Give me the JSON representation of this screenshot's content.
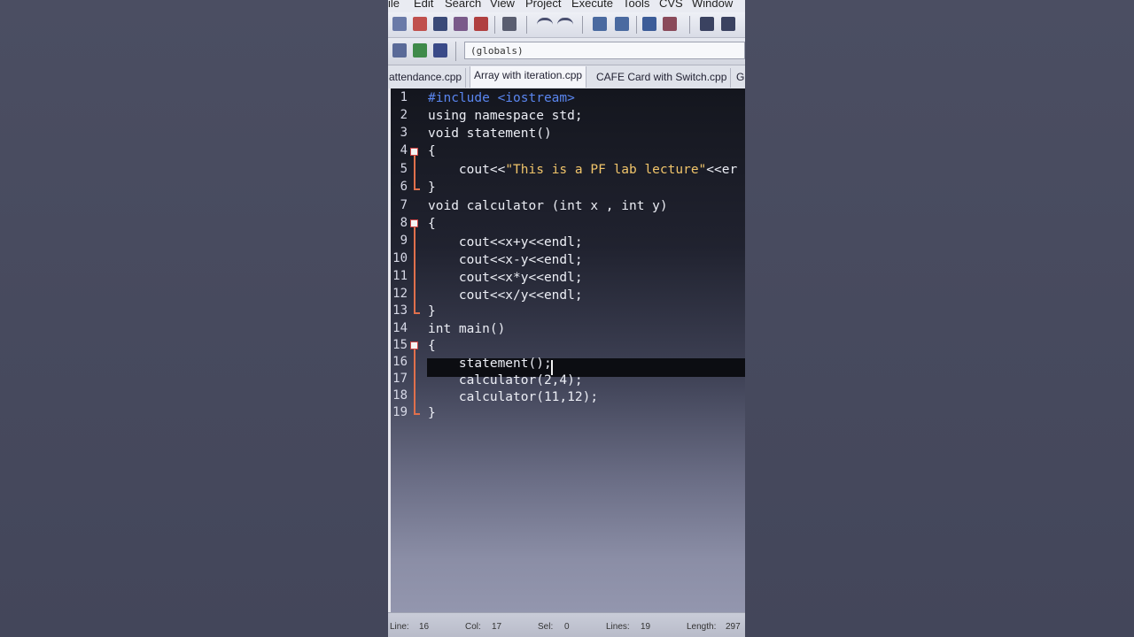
{
  "menu": [
    "ile",
    "Edit",
    "Search",
    "View",
    "Project",
    "Execute",
    "Tools",
    "CVS",
    "Window"
  ],
  "toolbar": {
    "scope_dropdown": "(globals)"
  },
  "tabs": [
    {
      "label": "attendance.cpp",
      "active": false
    },
    {
      "label": "Array with iteration.cpp",
      "active": true
    },
    {
      "label": "CAFE Card with Switch.cpp",
      "active": false
    },
    {
      "label": "G",
      "active": false
    }
  ],
  "editor": {
    "line_numbers": [
      "1",
      "2",
      "3",
      "4",
      "5",
      "6",
      "7",
      "8",
      "9",
      "10",
      "11",
      "12",
      "13",
      "14",
      "15",
      "16",
      "17",
      "18",
      "19"
    ],
    "lines": {
      "l1": "#include <iostream>",
      "l2": "using namespace std;",
      "l3": "void statement()",
      "l4": "{",
      "l5_a": "    cout<<",
      "l5_str": "\"This is a PF lab lecture\"",
      "l5_b": "<<er",
      "l6": "}",
      "l7": "void calculator (int x , int y)",
      "l8": "{",
      "l9": "    cout<<x+y<<endl;",
      "l10": "    cout<<x-y<<endl;",
      "l11": "    cout<<x*y<<endl;",
      "l12": "    cout<<x/y<<endl;",
      "l13": "}",
      "l14": "int main()",
      "l15": "{",
      "l16": "    statement();",
      "l17": "    calculator(2,4);",
      "l18": "    calculator(11,12);",
      "l19": "}"
    },
    "current_line": 16
  },
  "status": {
    "line_label": "Line:",
    "line_value": "16",
    "col_label": "Col:",
    "col_value": "17",
    "sel_label": "Sel:",
    "sel_value": "0",
    "lines_label": "Lines:",
    "lines_value": "19",
    "length_label": "Length:",
    "length_value": "297"
  },
  "colors": {
    "preprocessor": "#5a86f0",
    "string": "#f0c46a",
    "fold_marker": "#e0704c"
  }
}
